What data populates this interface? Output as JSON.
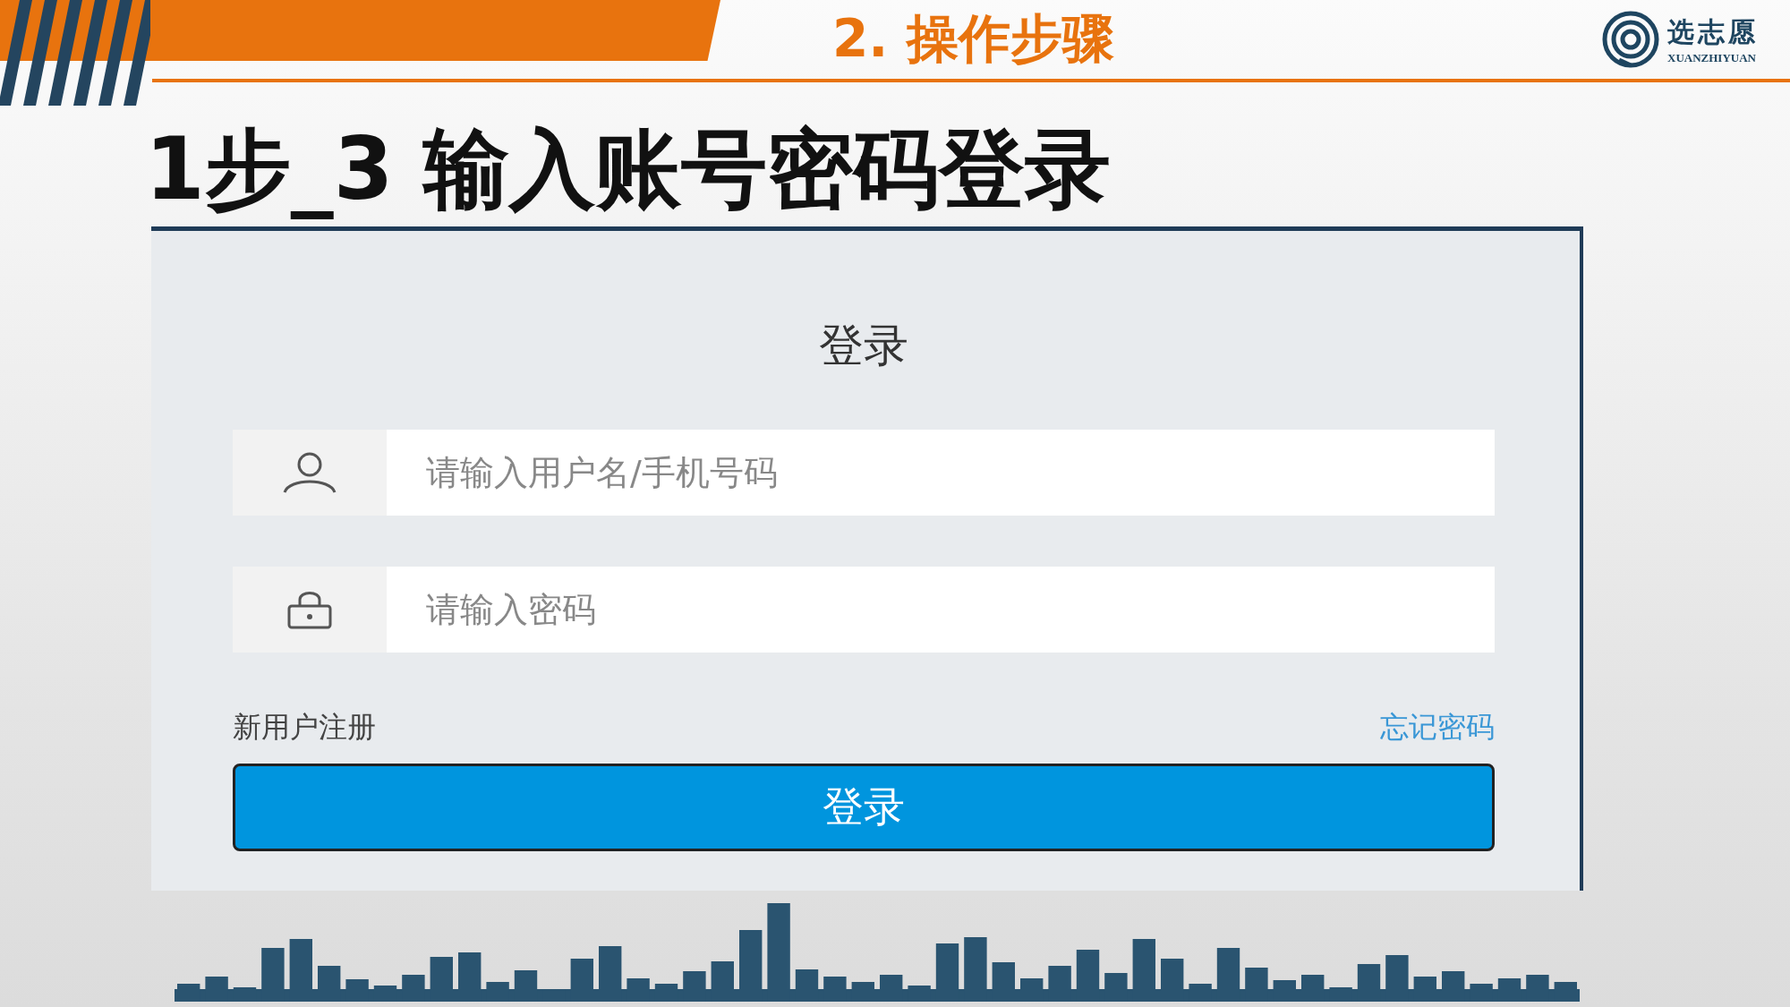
{
  "header": {
    "section_title": "2. 操作步骤",
    "logo": {
      "name": "选志愿",
      "subtitle": "XUANZHIYUAN"
    }
  },
  "heading": "1步_3 输入账号密码登录",
  "login_form": {
    "title": "登录",
    "fields": [
      {
        "kind": "user",
        "placeholder": "请输入用户名/手机号码"
      },
      {
        "kind": "password",
        "placeholder": "请输入密码"
      }
    ],
    "register_link": "新用户注册",
    "forgot_link": "忘记密码",
    "submit_button": "登录"
  }
}
